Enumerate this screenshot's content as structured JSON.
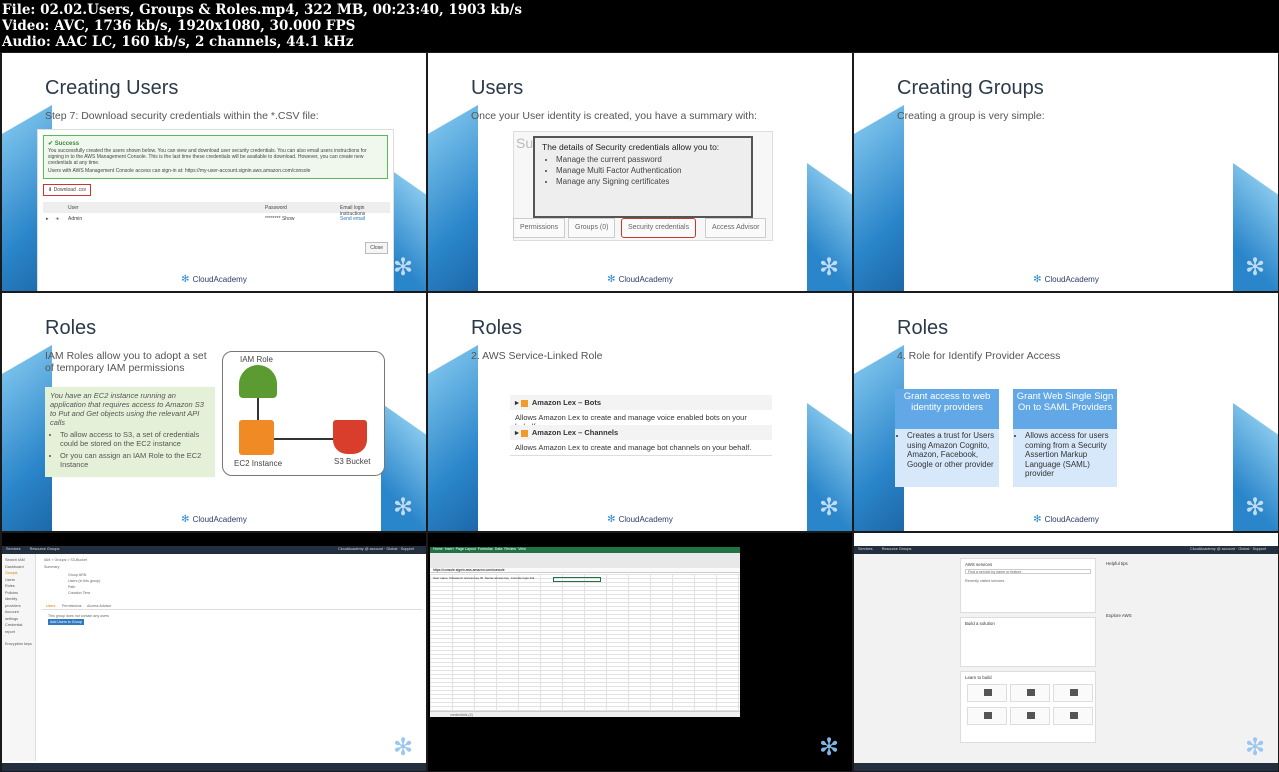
{
  "header": {
    "file_line": "File: 02.02.Users, Groups & Roles.mp4, 322 MB, 00:23:40, 1903 kb/s",
    "video_line": "Video: AVC, 1736 kb/s, 1920x1080, 30.000 FPS",
    "audio_line": "Audio: AAC LC, 160 kb/s, 2 channels, 44.1 kHz"
  },
  "brand": "CloudAcademy",
  "colors": {
    "accent_blue": "#1f7fc7",
    "success_green": "#5cb85c",
    "aws_navy": "#232f3e",
    "excel_green": "#217346"
  },
  "slides": {
    "s1": {
      "title": "Creating Users",
      "subtitle": "Step 7: Download security credentials within the *.CSV file:",
      "success_title": "Success",
      "success_body": "You successfully created the users shown below. You can view and download user security credentials. You can also email users instructions for signing in to the AWS Management Console. This is the last time these credentials will be available to download. However, you can create new credentials at any time.",
      "success_link": "Users with AWS Management Console access can sign-in at: https://my-user-account.signin.aws.amazon.com/console",
      "download_label": "Download .csv",
      "col_user": "User",
      "col_password": "Password",
      "col_email": "Email login instructions",
      "row_user": "Admin",
      "row_password": "******** Show",
      "row_email": "Send email",
      "close_label": "Close"
    },
    "s2": {
      "title": "Users",
      "subtitle": "Once your User identity is created, you have a summary with:",
      "summary_stub": "Su",
      "popup_head": "The details of Security credentials allow you to:",
      "popup_items": [
        "Manage the current password",
        "Manage Multi Factor Authentication",
        "Manage any Signing certificates"
      ],
      "tabs": [
        "Permissions",
        "Groups (0)",
        "Security credentials",
        "Access Advisor"
      ]
    },
    "s3": {
      "title": "Creating Groups",
      "subtitle": "Creating a group is very simple:"
    },
    "s4": {
      "title": "Roles",
      "intro": "IAM Roles allow you to adopt a set of temporary IAM permissions",
      "scenario": "You have an EC2 instance running an application that requires access to Amazon S3 to Put and Get objects using the relevant API calls",
      "bullets": [
        "To allow access to S3, a set of credentials could be stored on the EC2 instance",
        "Or you can assign an IAM Role to the EC2 Instance"
      ],
      "label_role": "IAM Role",
      "label_ec2": "EC2 Instance",
      "label_s3": "S3 Bucket"
    },
    "s5": {
      "title": "Roles",
      "subtitle": "2.   AWS Service-Linked Role",
      "cards": [
        {
          "head": "Amazon Lex – Bots",
          "desc": "Allows Amazon Lex to create and manage voice enabled bots on your behalf."
        },
        {
          "head": "Amazon Lex – Channels",
          "desc": "Allows Amazon Lex to create and manage bot channels on your behalf."
        }
      ]
    },
    "s6": {
      "title": "Roles",
      "subtitle": "4.   Role for Identify Provider Access",
      "col1_head": "Grant access to web identity providers",
      "col1_body": "Creates a trust for Users using Amazon Cognito, Amazon, Facebook, Google or other provider",
      "col2_head": "Grant Web Single Sign On to SAML Providers",
      "col2_body": "Allows access for users coming from a Security Assertion Markup Language (SAML) provider"
    }
  },
  "shots": {
    "iam": {
      "top_services": "Services",
      "top_groups": "Resource Groups",
      "top_right": "CloudAcademy @ account  ·  Global  ·  Support",
      "side_items": [
        "Search IAM",
        "Dashboard",
        "Groups",
        "Users",
        "Roles",
        "Policies",
        "Identity providers",
        "Account settings",
        "Credential report",
        "Encryption keys"
      ],
      "breadcrumb": "IAM > Groups > S3-Bucket",
      "summary": "Summary",
      "fields": [
        "Group ARN",
        "Users (in this group)",
        "Path",
        "Creation Time"
      ],
      "tabs": [
        "Users",
        "Permissions",
        "Access Advisor"
      ],
      "empty": "This group does not contain any users",
      "add_btn": "Add Users to Group"
    },
    "excel": {
      "tabs": [
        "Home",
        "Insert",
        "Page Layout",
        "Formulas",
        "Data",
        "Review",
        "View"
      ],
      "formula": "https://console.signin.aws.amazon.com/console",
      "headers": [
        "User name",
        "Password",
        "Access key ID",
        "Secret access key",
        "Console login link"
      ],
      "sheet_tab": "credentials (4)"
    },
    "console": {
      "panel_title": "AWS services",
      "find_placeholder": "Find a service by name or feature",
      "recent": "Recently visited services",
      "build_title": "Build a solution",
      "learn_title": "Learn to build",
      "helpful": "Helpful tips",
      "explore": "Explore AWS"
    }
  }
}
